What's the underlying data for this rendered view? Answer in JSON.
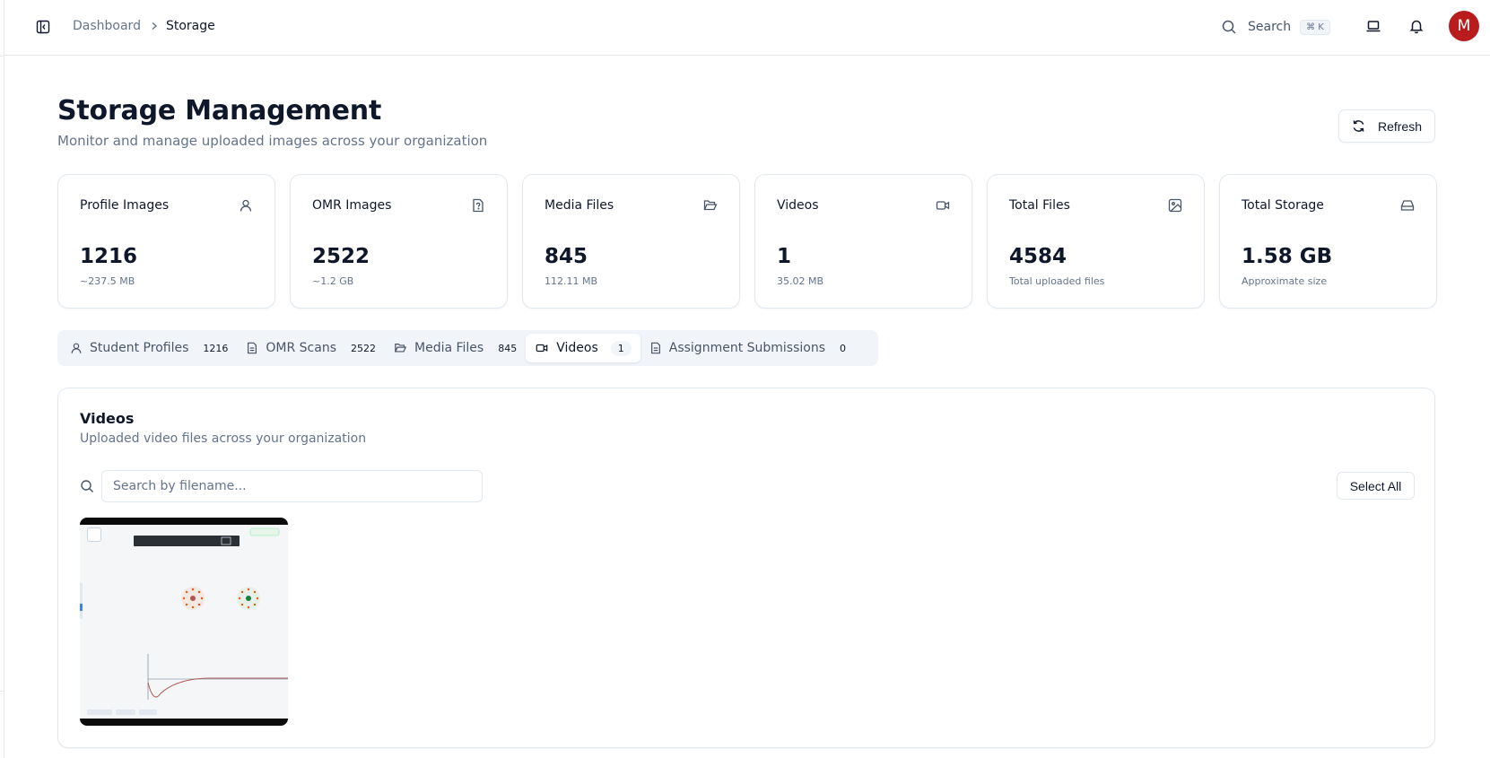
{
  "header": {
    "breadcrumb": [
      "Dashboard",
      "Storage"
    ],
    "search_label": "Search",
    "search_shortcut": "⌘ K",
    "avatar_initial": "M"
  },
  "page": {
    "title": "Storage Management",
    "subtitle": "Monitor and manage uploaded images across your organization",
    "refresh_label": "Refresh"
  },
  "stats": [
    {
      "label": "Profile Images",
      "value": "1216",
      "sub": "~237.5 MB",
      "icon": "user-icon"
    },
    {
      "label": "OMR Images",
      "value": "2522",
      "sub": "~1.2 GB",
      "icon": "file-question-icon"
    },
    {
      "label": "Media Files",
      "value": "845",
      "sub": "112.11 MB",
      "icon": "folder-open-icon"
    },
    {
      "label": "Videos",
      "value": "1",
      "sub": "35.02 MB",
      "icon": "video-icon"
    },
    {
      "label": "Total Files",
      "value": "4584",
      "sub": "Total uploaded files",
      "icon": "image-icon"
    },
    {
      "label": "Total Storage",
      "value": "1.58 GB",
      "sub": "Approximate size",
      "icon": "hard-drive-icon"
    }
  ],
  "tabs": [
    {
      "label": "Student Profiles",
      "count": "1216",
      "icon": "user-icon"
    },
    {
      "label": "OMR Scans",
      "count": "2522",
      "icon": "file-text-icon"
    },
    {
      "label": "Media Files",
      "count": "845",
      "icon": "folder-open-icon"
    },
    {
      "label": "Videos",
      "count": "1",
      "icon": "video-icon",
      "active": true
    },
    {
      "label": "Assignment Submissions",
      "count": "0",
      "icon": "file-text-icon"
    }
  ],
  "panel": {
    "title": "Videos",
    "subtitle": "Uploaded video files across your organization",
    "search_placeholder": "Search by filename...",
    "select_all_label": "Select All"
  },
  "colors": {
    "avatar_bg": "#b91c1c",
    "border": "#e2e8f0",
    "muted_text": "#64748b"
  }
}
